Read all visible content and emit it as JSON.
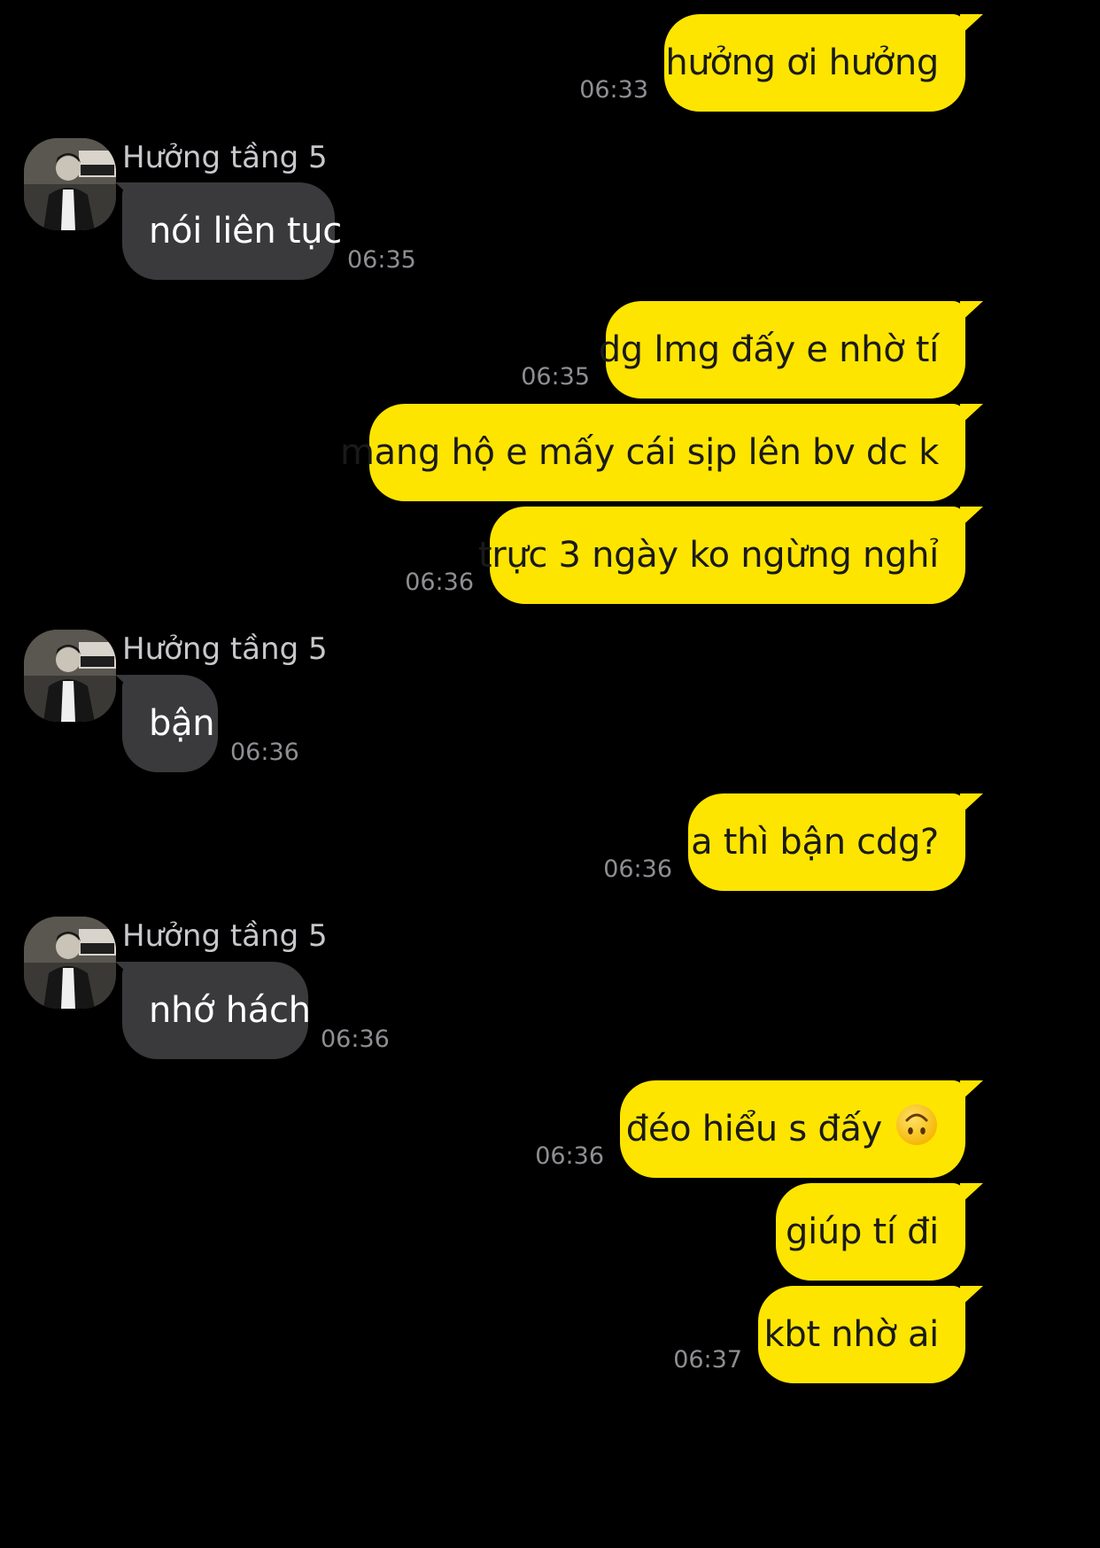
{
  "contact": {
    "name": "Hưởng tầng 5",
    "avatar_icon": "profile-photo-avatar"
  },
  "colors": {
    "background": "#000000",
    "outgoing_bubble": "#FEE500",
    "incoming_bubble": "#3a3a3c",
    "timestamp": "#8e8e93"
  },
  "messages": [
    {
      "text": "hưởng ơi hưởng",
      "time": "06:33"
    },
    {
      "text": "nói liên tục",
      "time": "06:35"
    },
    {
      "text": "dg lmg đấy e nhờ tí",
      "time": "06:35"
    },
    {
      "text": "mang hộ e mấy cái sịp lên bv dc k"
    },
    {
      "text": "trực 3 ngày ko ngừng nghỉ",
      "time": "06:36"
    },
    {
      "text": "bận",
      "time": "06:36"
    },
    {
      "text": "a thì bận cdg?",
      "time": "06:36"
    },
    {
      "text": "nhớ hách",
      "time": "06:36"
    },
    {
      "text": "đéo hiểu s đấy",
      "time": "06:36",
      "emoji": "upside-down-face-icon"
    },
    {
      "text": "giúp tí đi"
    },
    {
      "text": "kbt nhờ ai",
      "time": "06:37"
    }
  ]
}
